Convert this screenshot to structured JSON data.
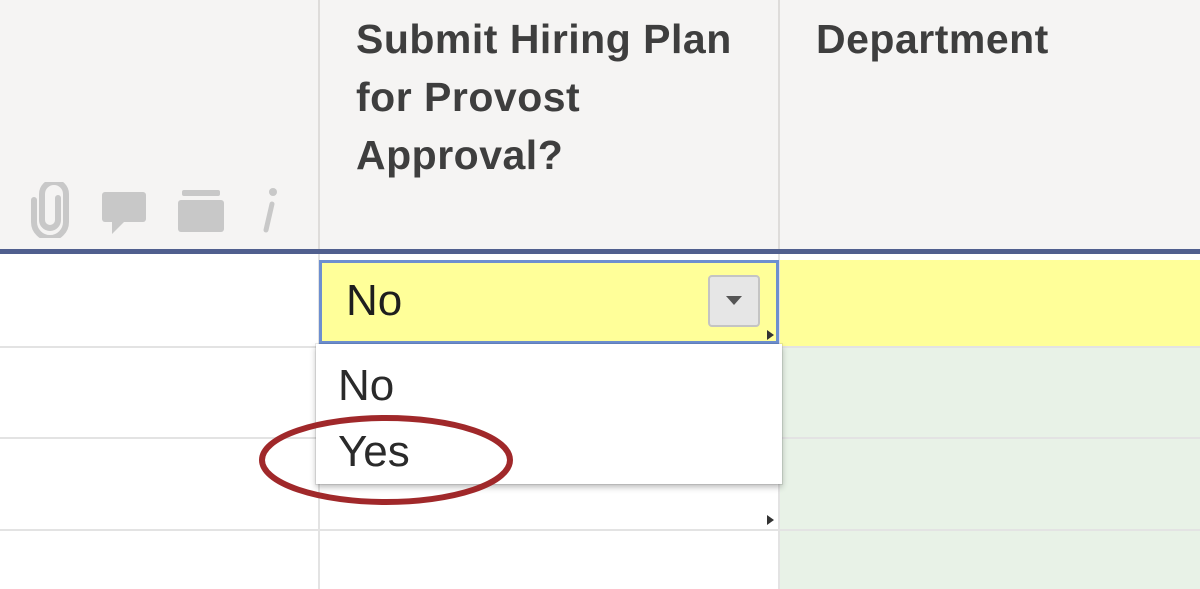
{
  "header": {
    "column_1_title": "Submit Hiring Plan for Provost Approval?",
    "column_2_title": "Department",
    "row_icons": [
      "paperclip-icon",
      "comment-icon",
      "proof-icon",
      "info-icon"
    ]
  },
  "active_cell": {
    "value": "No"
  },
  "dropdown": {
    "options": [
      "No",
      "Yes"
    ],
    "highlighted_option": "Yes"
  },
  "colors": {
    "header_bg": "#f5f4f3",
    "header_rule": "#505f8e",
    "active_cell_bg": "#ffff99",
    "active_cell_border": "#6d8fd0",
    "row_green": "#e8f2e7",
    "annotation_ellipse": "#a0282a"
  }
}
